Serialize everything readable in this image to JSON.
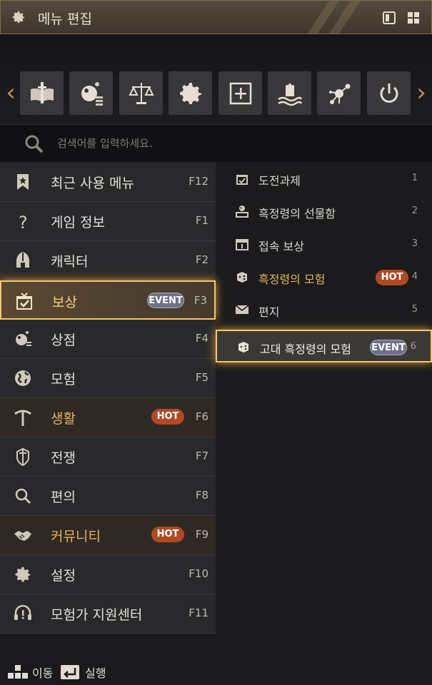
{
  "header": {
    "title": "메뉴 편집",
    "icon": "gear-icon",
    "buttons": [
      "panel-icon",
      "grid-icon"
    ]
  },
  "quickbar": {
    "items": [
      {
        "name": "codex-icon"
      },
      {
        "name": "shop-icon"
      },
      {
        "name": "scales-icon"
      },
      {
        "name": "gear-icon"
      },
      {
        "name": "expand-icon"
      },
      {
        "name": "hand-water-icon"
      },
      {
        "name": "node-icon"
      },
      {
        "name": "power-icon"
      }
    ]
  },
  "search": {
    "placeholder": "검색어를 입력하세요."
  },
  "menu": [
    {
      "label": "최근 사용 메뉴",
      "key": "F12",
      "icon": "bookmark-star-icon"
    },
    {
      "label": "게임 정보",
      "key": "F1",
      "icon": "question-icon"
    },
    {
      "label": "캐릭터",
      "key": "F2",
      "icon": "helmet-icon"
    },
    {
      "label": "보상",
      "key": "F3",
      "icon": "gift-box-icon",
      "badge": "EVENT",
      "active": true
    },
    {
      "label": "상점",
      "key": "F4",
      "icon": "shop-icon"
    },
    {
      "label": "모험",
      "key": "F5",
      "icon": "globe-icon"
    },
    {
      "label": "생활",
      "key": "F6",
      "icon": "pickaxe-icon",
      "badge": "HOT",
      "hot": true
    },
    {
      "label": "전쟁",
      "key": "F7",
      "icon": "sword-shield-icon"
    },
    {
      "label": "편의",
      "key": "F8",
      "icon": "search-icon"
    },
    {
      "label": "커뮤니티",
      "key": "F9",
      "icon": "handshake-icon",
      "badge": "HOT",
      "hot": true
    },
    {
      "label": "설정",
      "key": "F10",
      "icon": "gear-icon"
    },
    {
      "label": "모험가 지원센터",
      "key": "F11",
      "icon": "headset-icon"
    }
  ],
  "submenu": [
    {
      "label": "도전과제",
      "num": "1",
      "icon": "trophy-icon"
    },
    {
      "label": "흑정령의 선물함",
      "num": "2",
      "icon": "spirit-gift-icon"
    },
    {
      "label": "접속 보상",
      "num": "3",
      "icon": "calendar-icon"
    },
    {
      "label": "흑정령의 모험",
      "num": "4",
      "icon": "dice-icon",
      "badge": "HOT",
      "hot": true
    },
    {
      "label": "편지",
      "num": "5",
      "icon": "mail-icon"
    },
    {
      "label": "고대 흑정령의 모험",
      "num": "6",
      "icon": "dice-icon",
      "badge": "EVENT",
      "active": true
    }
  ],
  "footer": {
    "move": "이동",
    "execute": "실행"
  },
  "colors": {
    "accent": "#f5c46a",
    "hot": "#b04a25",
    "event": "#6f7286",
    "text_gold": "#e4b25a"
  }
}
